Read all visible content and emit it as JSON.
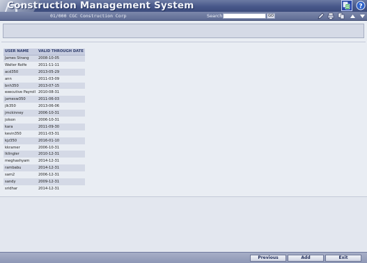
{
  "app": {
    "title": "Construction Management System"
  },
  "subbar": {
    "company": "01/000  CGC Construction Corp",
    "search_label": "Search",
    "search_value": "",
    "go_label": "GO"
  },
  "table": {
    "headers": [
      "USER NAME",
      "VALID THROUGH DATE"
    ],
    "rows": [
      [
        "James Strang",
        "2008-10-05"
      ],
      [
        "Walter Rolfe",
        "2011-11-11"
      ],
      [
        "acd350",
        "2013-05-29"
      ],
      [
        "ann",
        "2011-03-09"
      ],
      [
        "bnh350",
        "2013-07-15"
      ],
      [
        "executive Payroll",
        "2010-08-31"
      ],
      [
        "jamesw350",
        "2011-06-03"
      ],
      [
        "jlk350",
        "2013-06-06"
      ],
      [
        "jmckinney",
        "2006-10-31"
      ],
      [
        "jolson",
        "2006-10-31"
      ],
      [
        "kara",
        "2011-09-30"
      ],
      [
        "kevin350",
        "2011-03-31"
      ],
      [
        "kjz350",
        "2016-01-10"
      ],
      [
        "kkramer",
        "2006-10-31"
      ],
      [
        "lklingler",
        "2010-12-31"
      ],
      [
        "meghashyam",
        "2014-12-31"
      ],
      [
        "rambabu",
        "2014-12-31"
      ],
      [
        "sam2",
        "2006-12-31"
      ],
      [
        "sandy",
        "2009-12-31"
      ],
      [
        "sridhar",
        "2014-12-31"
      ]
    ]
  },
  "footer": {
    "previous_label": "Previous",
    "add_label": "Add",
    "exit_label": "Exit"
  },
  "icons": {
    "app_switch": "app-switch-icon",
    "help": "help-icon",
    "tools": [
      "pen-icon",
      "print-icon",
      "copy-icon",
      "arrow-up-icon",
      "arrow-down-icon"
    ]
  },
  "colors": {
    "title_bar": "#48588a",
    "row_stripe": "#d4d9e6",
    "header_bg": "#c7cde0",
    "button_text": "#1d2a57"
  }
}
